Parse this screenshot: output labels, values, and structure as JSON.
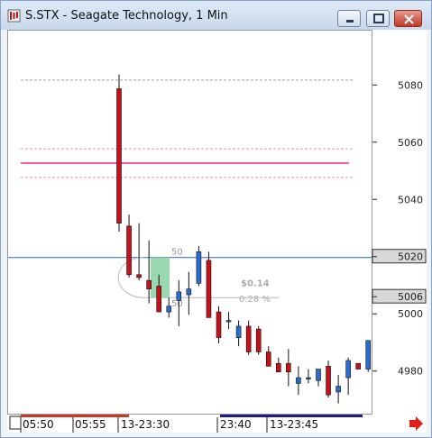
{
  "window": {
    "title": "S.STX - Seagate Technology, 1 Min",
    "icon": "chart-app-icon",
    "controls": [
      "minimize-icon",
      "maximize-icon",
      "close-icon"
    ]
  },
  "colors": {
    "bull": "#2a6ccf",
    "bear": "#c4121a",
    "wick": "#111111",
    "hline_blue": "#1f6fd1",
    "hline_pink": "#ff5aa8",
    "hline_dashed": "#e48fc3",
    "marker_box": "#d8d8d8",
    "trade_box": "#8fd4a6",
    "scroll_red": "#c93a22",
    "scroll_navy": "#1c1c8c",
    "arrow_red": "#e0201a"
  },
  "price_axis": {
    "ticks": [
      "5080",
      "5060",
      "5040",
      "5020",
      "5006",
      "5000",
      "4980"
    ],
    "price_markers": [
      "5020",
      "5006"
    ]
  },
  "time_axis": {
    "labels": [
      "05:50",
      "05:55",
      "13-23:30",
      "23:40",
      "13-23:45"
    ]
  },
  "trade_annotation": {
    "profit": "$0.14",
    "percent": "0.28 %",
    "qty_top": "50",
    "qty_bottom": "50"
  },
  "chart_data": {
    "type": "candlestick",
    "ylim": [
      4967,
      5093
    ],
    "price_lines": [
      {
        "price": 5082,
        "style": "dashed-gray"
      },
      {
        "price": 5058,
        "style": "dashed-pink"
      },
      {
        "price": 5053,
        "style": "solid-pink"
      },
      {
        "price": 5048,
        "style": "dashed-pink"
      },
      {
        "price": 5020,
        "style": "solid-blue"
      }
    ],
    "candles": [
      {
        "o": 5079,
        "h": 5084,
        "l": 5029,
        "c": 5032
      },
      {
        "o": 5031,
        "h": 5035,
        "l": 5013,
        "c": 5014
      },
      {
        "o": 5014,
        "h": 5032,
        "l": 5012,
        "c": 5013
      },
      {
        "o": 5012,
        "h": 5026,
        "l": 5004,
        "c": 5009
      },
      {
        "o": 5010,
        "h": 5014,
        "l": 5001,
        "c": 5001
      },
      {
        "o": 5001,
        "h": 5006,
        "l": 4999,
        "c": 5003
      },
      {
        "o": 5005,
        "h": 5012,
        "l": 4996,
        "c": 5008
      },
      {
        "o": 5007,
        "h": 5015,
        "l": 5000,
        "c": 5009
      },
      {
        "o": 5011,
        "h": 5024,
        "l": 5010,
        "c": 5022
      },
      {
        "o": 5019,
        "h": 5022,
        "l": 4999,
        "c": 4999
      },
      {
        "o": 5001,
        "h": 5003,
        "l": 4990,
        "c": 4992
      },
      {
        "o": 4998,
        "h": 5001,
        "l": 4995,
        "c": 4998
      },
      {
        "o": 4992,
        "h": 4998,
        "l": 4989,
        "c": 4996
      },
      {
        "o": 4996,
        "h": 4998,
        "l": 4986,
        "c": 4987
      },
      {
        "o": 4995,
        "h": 4996,
        "l": 4986,
        "c": 4987
      },
      {
        "o": 4987,
        "h": 4989,
        "l": 4982,
        "c": 4982
      },
      {
        "o": 4983,
        "h": 4985,
        "l": 4980,
        "c": 4980
      },
      {
        "o": 4983,
        "h": 4988,
        "l": 4975,
        "c": 4980
      },
      {
        "o": 4976,
        "h": 4982,
        "l": 4972,
        "c": 4978
      },
      {
        "o": 4978,
        "h": 4981,
        "l": 4976,
        "c": 4978
      },
      {
        "o": 4977,
        "h": 4981,
        "l": 4975,
        "c": 4981
      },
      {
        "o": 4982,
        "h": 4984,
        "l": 4971,
        "c": 4972
      },
      {
        "o": 4973,
        "h": 4979,
        "l": 4969,
        "c": 4975
      },
      {
        "o": 4978,
        "h": 4985,
        "l": 4972,
        "c": 4984
      },
      {
        "o": 4983,
        "h": 4983,
        "l": 4981,
        "c": 4981
      },
      {
        "o": 4981,
        "h": 4991,
        "l": 4980,
        "c": 4991
      }
    ]
  }
}
